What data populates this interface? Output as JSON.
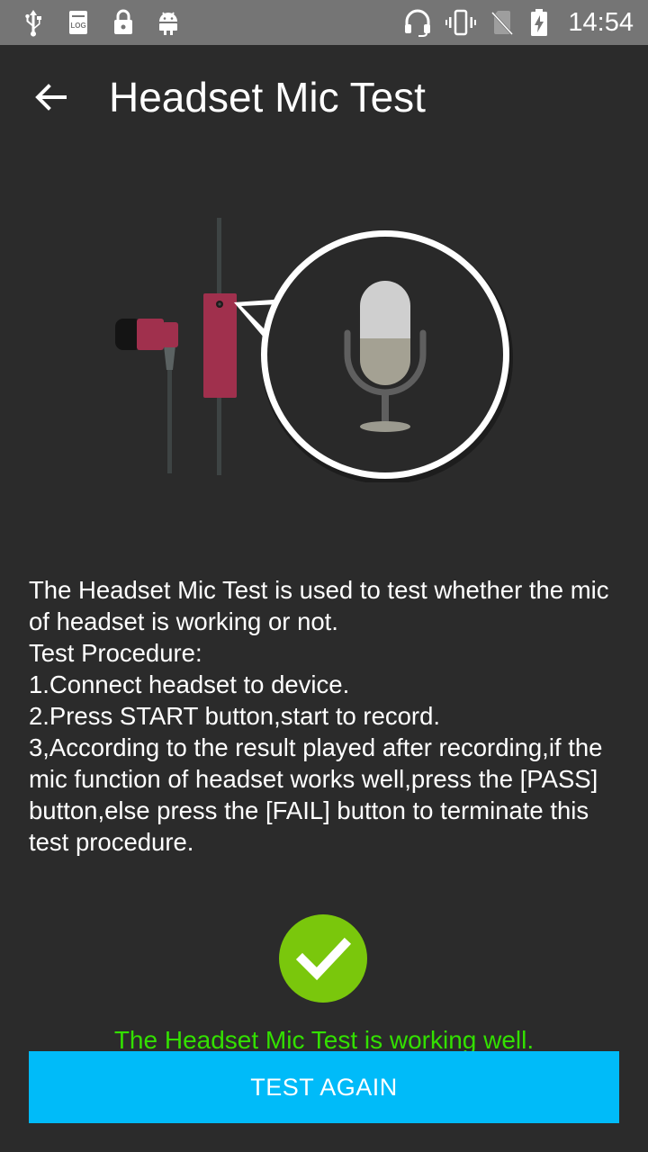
{
  "status_bar": {
    "time": "14:54",
    "left_icons": [
      "usb-icon",
      "log-icon",
      "lock-icon",
      "android-icon"
    ],
    "right_icons": [
      "headset-icon",
      "vibrate-icon",
      "no-sim-icon",
      "battery-charging-icon"
    ]
  },
  "app_bar": {
    "title": "Headset Mic Test",
    "back_icon": "arrow-back-icon"
  },
  "description": {
    "lines": [
      "The Headset Mic Test is used to test whether the mic of headset is working or not.",
      "Test Procedure:",
      "1.Connect headset to device.",
      "2.Press START button,start to record.",
      "3,According to the result played after recording,if the mic function of headset works well,press the [PASS] button,else press the [FAIL] button to terminate this test procedure."
    ]
  },
  "result": {
    "status_icon": "check-circle-icon",
    "message": "The Headset Mic Test is working well."
  },
  "button": {
    "label": "TEST AGAIN"
  },
  "colors": {
    "background": "#2b2b2b",
    "status_bar": "#757575",
    "accent_button": "#00bbf9",
    "success_green": "#33e000",
    "check_circle": "#7ac70c",
    "earbud_red": "#a0304d"
  }
}
